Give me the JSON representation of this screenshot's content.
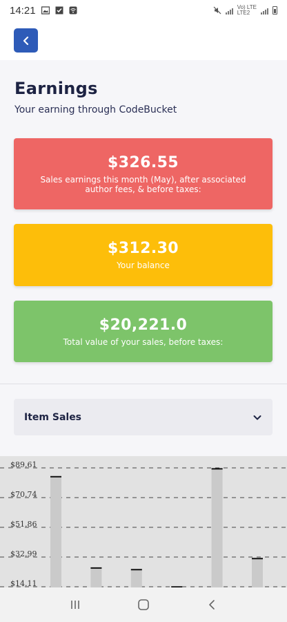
{
  "status_bar": {
    "time": "14:21",
    "network_label": "Vo) LTE",
    "network_sub": "LTE2"
  },
  "header": {
    "back_icon": "chevron-left-icon",
    "accent_color": "#2e5bb8"
  },
  "page": {
    "title": "Earnings",
    "subtitle": "Your earning through CodeBucket"
  },
  "cards": {
    "month": {
      "value": "$326.55",
      "label": "Sales earnings this month (May), after associated author fees, & before taxes:",
      "color": "#ee6664"
    },
    "balance": {
      "value": "$312.30",
      "label": "Your balance",
      "color": "#fdbe0a"
    },
    "total": {
      "value": "$20,221.0",
      "label": "Total value of your sales, before taxes:",
      "color": "#7dc46a"
    }
  },
  "item_select": {
    "selected": "Item Sales",
    "icon": "chevron-down-icon"
  },
  "chart_data": {
    "type": "bar",
    "title": "",
    "xlabel": "",
    "ylabel": "",
    "ytick_labels": [
      "$89.61",
      "$70.74",
      "$51.86",
      "$32.99",
      "$14.11"
    ],
    "ytick_values": [
      89.61,
      70.74,
      51.86,
      32.99,
      14.11
    ],
    "ylim": [
      14.11,
      89.61
    ],
    "grid": true,
    "categories": [
      "",
      "",
      "",
      "",
      "",
      ""
    ],
    "values": [
      84,
      26,
      25,
      14,
      89,
      32
    ]
  },
  "nav": {
    "recents_icon": "recents-icon",
    "home_icon": "home-icon",
    "back_icon": "back-icon"
  }
}
